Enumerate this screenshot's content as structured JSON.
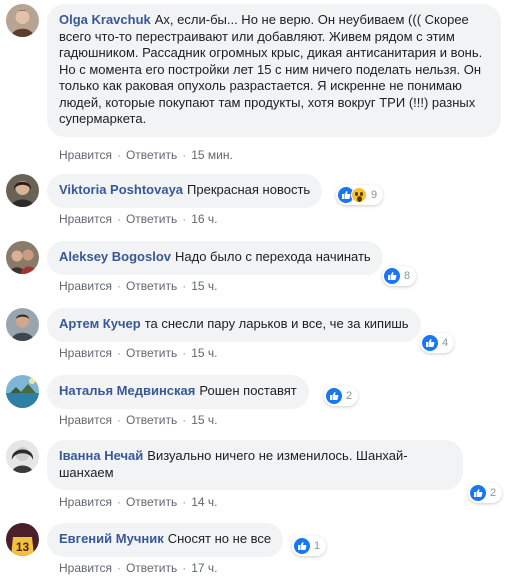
{
  "actions": {
    "like": "Нравится",
    "reply": "Ответить",
    "separator": "·"
  },
  "comments": [
    {
      "author": "Olga Kravchuk",
      "text": "Ах, если-бы... Но не верю. Он неубиваем ((( Скорее всего что-то перестраивают или добавляют. Живем рядом с этим гадюшником. Рассадник огромных крыс, дикая антисанитария и вонь. Но с момента его постройки лет 15 с ним ничего поделать нельзя. Он только как раковая опухоль разрастается. Я искренне не понимаю людей, которые покупают там продукты, хотя вокруг ТРИ (!!!) разных супермаркета.",
      "time": "15 мин.",
      "reactions": null
    },
    {
      "author": "Viktoria Poshtovaya",
      "text": "Прекрасная новость",
      "time": "16 ч.",
      "reactions": "9"
    },
    {
      "author": "Aleksey Bogoslov",
      "text": "Надо было с перехода начинать",
      "time": "15 ч.",
      "reactions": "8"
    },
    {
      "author": "Артем Кучер",
      "text": "та снесли пару ларьков и все, че за кипишь",
      "time": "15 ч.",
      "reactions": "4"
    },
    {
      "author": "Наталья Медвинская",
      "text": "Рошен поставят",
      "time": "15 ч.",
      "reactions": "2"
    },
    {
      "author": "Іванна Нечай",
      "text": "Визуально ничего не изменилось. Шанхай-шанхаем",
      "time": "14 ч.",
      "reactions": "2"
    },
    {
      "author": "Евгений Мучник",
      "text": "Сносят но не все",
      "time": "17 ч.",
      "reactions": "1"
    }
  ],
  "icons": [
    "like-icon",
    "wow-icon",
    "avatar"
  ],
  "colors": {
    "author": "#385898",
    "bubble": "#f2f3f5",
    "like": "#1877f2",
    "meta": "#616770"
  }
}
